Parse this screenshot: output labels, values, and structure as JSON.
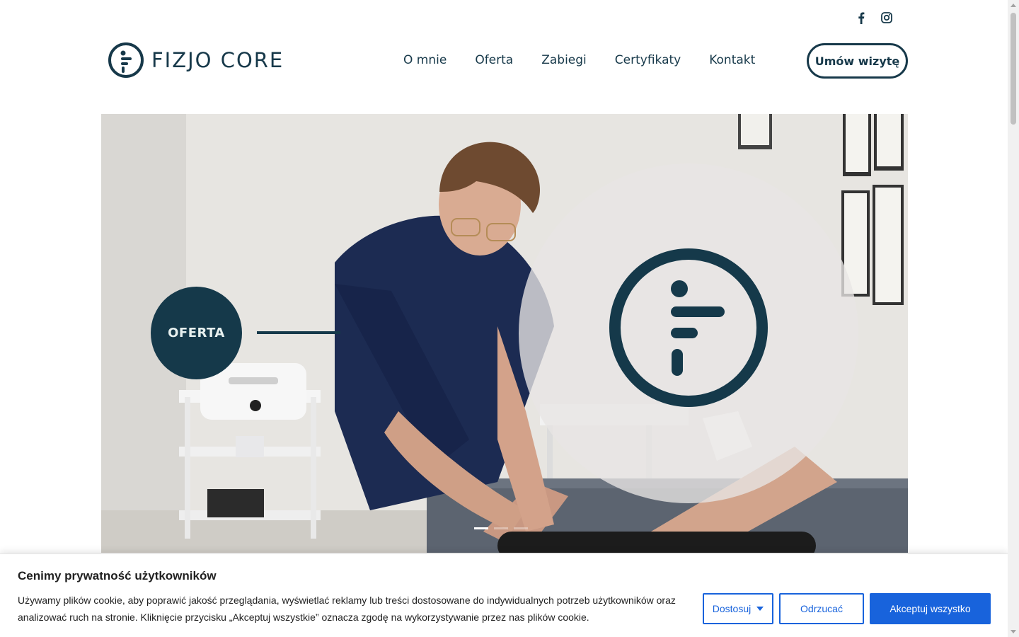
{
  "social": {
    "facebook": "facebook-icon",
    "instagram": "instagram-icon"
  },
  "header": {
    "logo_text": "FIZJO CORE",
    "nav": [
      "O mnie",
      "Oferta",
      "Zabiegi",
      "Certyfikaty",
      "Kontakt"
    ],
    "cta": "Umów wizytę"
  },
  "hero": {
    "badge": "OFERTA",
    "slides": {
      "count": 3,
      "active": 1
    }
  },
  "cookie": {
    "title": "Cenimy prywatność użytkowników",
    "text": "Używamy plików cookie, aby poprawić jakość przeglądania, wyświetlać reklamy lub treści dostosowane do indywidualnych potrzeb użytkowników oraz analizować ruch na stronie. Kliknięcie przycisku „Akceptuj wszystkie” oznacza zgodę na wykorzystywanie przez nas plików cookie.",
    "customize": "Dostosuj",
    "reject": "Odrzucać",
    "accept": "Akceptuj wszystko"
  },
  "colors": {
    "brand": "#15394a",
    "cookie_accent": "#1863dc"
  }
}
